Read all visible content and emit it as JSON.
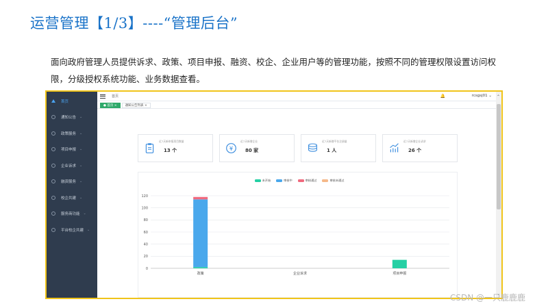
{
  "slide": {
    "title": "运营管理【1/3】----“管理后台”",
    "description": "面向政府管理人员提供诉求、政策、项目申报、融资、校企、企业用户等的管理功能，按照不同的管理权限设置访问权限，分级授权系统功能、业务数据查看。"
  },
  "app": {
    "sidebar": {
      "items": [
        {
          "label": "首页",
          "icon": "home-icon",
          "active": true
        },
        {
          "label": "通知公告",
          "icon": "circle-icon"
        },
        {
          "label": "政策服务",
          "icon": "circle-icon"
        },
        {
          "label": "项目申报",
          "icon": "circle-icon"
        },
        {
          "label": "企业诉求",
          "icon": "circle-icon"
        },
        {
          "label": "融资服务",
          "icon": "circle-icon"
        },
        {
          "label": "校企共建",
          "icon": "circle-icon"
        },
        {
          "label": "服务商功能",
          "icon": "circle-icon"
        },
        {
          "label": "平台校企共建",
          "icon": "circle-icon"
        }
      ]
    },
    "header": {
      "breadcrumb": "首页",
      "user": "rcsgsj01"
    },
    "tabs": [
      {
        "label": "● 首页 ×",
        "active": true
      },
      {
        "label": "通知公告列表 ×",
        "active": false
      }
    ],
    "stats": [
      {
        "label": "近7天新申报项目数量",
        "value": "13 个",
        "icon": "clipboard-icon",
        "color": "#3f8fdf"
      },
      {
        "label": "近7天新增企业",
        "value": "80 家",
        "icon": "money-icon",
        "color": "#3f8fdf"
      },
      {
        "label": "近7天新增平台注册量",
        "value": "1 人",
        "icon": "coins-icon",
        "color": "#3f8fdf"
      },
      {
        "label": "近7天新增企业诉求",
        "value": "26 个",
        "icon": "trend-icon",
        "color": "#3f8fdf"
      }
    ]
  },
  "chart_data": {
    "type": "bar",
    "stacked": true,
    "categories": [
      "政策",
      "企业诉求",
      "项目申报"
    ],
    "series": [
      {
        "name": "未开始",
        "color": "#25d0a4",
        "values": [
          2,
          0,
          14
        ]
      },
      {
        "name": "审核中",
        "color": "#4aa8ec",
        "values": [
          112,
          0,
          0
        ]
      },
      {
        "name": "审核通过",
        "color": "#f06a7e",
        "values": [
          4,
          0,
          0
        ]
      },
      {
        "name": "审核未通过",
        "color": "#f5b98a",
        "values": [
          0,
          0,
          0
        ]
      }
    ],
    "ylim": [
      0,
      120
    ],
    "yticks": [
      0,
      20,
      40,
      60,
      80,
      100,
      120
    ],
    "grid": true,
    "legend": "top-center"
  },
  "watermark": "CSDN @一只鹿鹿鹿"
}
